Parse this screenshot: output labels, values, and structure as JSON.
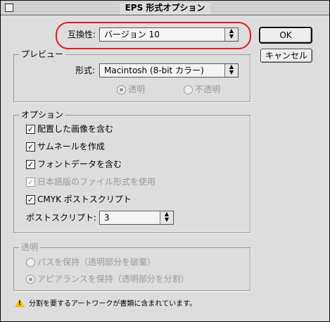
{
  "window": {
    "title": "EPS 形式オプション"
  },
  "compatibility": {
    "label": "互換性:",
    "value": "バージョン 10"
  },
  "buttons": {
    "ok": "OK",
    "cancel": "キャンセル"
  },
  "preview": {
    "group_label": "プレビュー",
    "format_label": "形式:",
    "format_value": "Macintosh (8-bit カラー)",
    "transparent": "透明",
    "opaque": "不透明"
  },
  "options": {
    "group_label": "オプション",
    "items": [
      {
        "label": "配置した画像を含む",
        "checked": true,
        "enabled": true
      },
      {
        "label": "サムネールを作成",
        "checked": true,
        "enabled": true
      },
      {
        "label": "フォントデータを含む",
        "checked": true,
        "enabled": true
      },
      {
        "label": "日本語版のファイル形式を使用",
        "checked": true,
        "enabled": false
      },
      {
        "label": "CMYK ポストスクリプト",
        "checked": true,
        "enabled": true
      }
    ],
    "postscript_label": "ポストスクリプト:",
    "postscript_value": "3"
  },
  "transparency": {
    "group_label": "透明",
    "preserve_paths": "パスを保持（透明部分を破棄）",
    "preserve_appearance": "アピアランスを保持（透明部分を分割）"
  },
  "warning": {
    "text": "分割を要するアートワークが書類に含まれています。"
  }
}
